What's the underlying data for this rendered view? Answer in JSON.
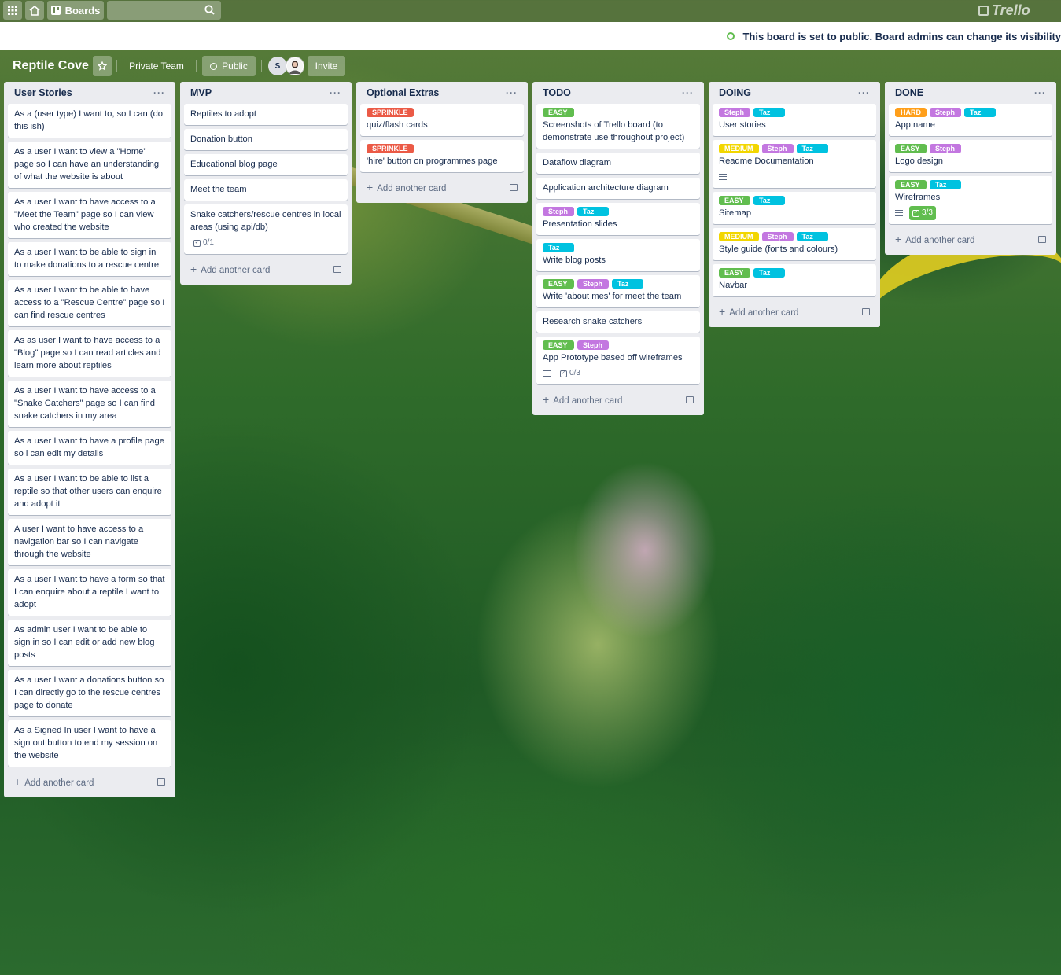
{
  "nav": {
    "boards_label": "Boards",
    "logo": "Trello"
  },
  "banner": {
    "text": "This board is set to public. Board admins can change its visibility"
  },
  "board": {
    "title": "Reptile Cove",
    "team": "Private Team",
    "visibility": "Public",
    "member_initial": "S",
    "invite": "Invite"
  },
  "colors": {
    "green": "#61bd4f",
    "yellow": "#f2d600",
    "orange": "#ff9f1a",
    "red": "#eb5a46",
    "purple": "#c377e0",
    "sky": "#00c2e0"
  },
  "add_card_label": "Add another card",
  "lists": [
    {
      "name": "User Stories",
      "cards": [
        {
          "title": "As a (user type) I want to, so I can (do this ish)"
        },
        {
          "title": "As a user I want to view a \"Home\" page so I can have an understanding of what the website is about"
        },
        {
          "title": "As a user I want to have access to a \"Meet the Team\" page so I can view who created the website"
        },
        {
          "title": "As a user I want to be able to sign in to make donations to a rescue centre"
        },
        {
          "title": "As a user I want to be able to have access to a \"Rescue Centre\" page so I can find rescue centres"
        },
        {
          "title": "As as user I want to have access to a \"Blog\" page so I can read articles and learn more about reptiles"
        },
        {
          "title": "As a user I want to have access to a \"Snake Catchers\" page so I can find snake catchers in my area"
        },
        {
          "title": "As a user I want to have a profile page so i can edit my details"
        },
        {
          "title": "As a user I want to be able to list a reptile so that other users can enquire and adopt it"
        },
        {
          "title": "A user I want to have access to a navigation bar so I can navigate through the website"
        },
        {
          "title": "As a user I want to have a form so that I can enquire about a reptile I want to adopt"
        },
        {
          "title": "As admin user I want to be able to sign in so I can edit or add new blog posts"
        },
        {
          "title": "As a user I want a donations button so I can directly go to the rescue centres page to donate"
        },
        {
          "title": "As a Signed In user I want to have a sign out button to end my session on the website"
        }
      ]
    },
    {
      "name": "MVP",
      "cards": [
        {
          "title": "Reptiles to adopt"
        },
        {
          "title": "Donation button"
        },
        {
          "title": "Educational blog page"
        },
        {
          "title": "Meet the team"
        },
        {
          "title": "Snake catchers/rescue centres in local areas (using api/db)",
          "checklist": "0/1"
        }
      ]
    },
    {
      "name": "Optional Extras",
      "cards": [
        {
          "title": "quiz/flash cards",
          "labels": [
            {
              "text": "SPRINKLE",
              "color": "#eb5a46"
            }
          ]
        },
        {
          "title": "'hire' button on programmes page",
          "labels": [
            {
              "text": "SPRINKLE",
              "color": "#eb5a46"
            }
          ]
        }
      ]
    },
    {
      "name": "TODO",
      "cards": [
        {
          "title": "Screenshots of Trello board (to demonstrate use throughout project)",
          "labels": [
            {
              "text": "EASY",
              "color": "#61bd4f"
            }
          ]
        },
        {
          "title": "Dataflow diagram"
        },
        {
          "title": "Application architecture diagram"
        },
        {
          "title": "Presentation slides",
          "labels": [
            {
              "text": "Steph",
              "color": "#c377e0"
            },
            {
              "text": "Taz",
              "color": "#00c2e0"
            }
          ]
        },
        {
          "title": "Write blog posts",
          "labels": [
            {
              "text": "Taz",
              "color": "#00c2e0"
            }
          ]
        },
        {
          "title": "Write 'about mes' for meet the team",
          "labels": [
            {
              "text": "EASY",
              "color": "#61bd4f"
            },
            {
              "text": "Steph",
              "color": "#c377e0"
            },
            {
              "text": "Taz",
              "color": "#00c2e0"
            }
          ]
        },
        {
          "title": "Research snake catchers"
        },
        {
          "title": "App Prototype based off wireframes",
          "labels": [
            {
              "text": "EASY",
              "color": "#61bd4f"
            },
            {
              "text": "Steph",
              "color": "#c377e0"
            }
          ],
          "description": true,
          "checklist": "0/3"
        }
      ]
    },
    {
      "name": "DOING",
      "cards": [
        {
          "title": "User stories",
          "labels": [
            {
              "text": "Steph",
              "color": "#c377e0"
            },
            {
              "text": "Taz",
              "color": "#00c2e0"
            }
          ]
        },
        {
          "title": "Readme Documentation",
          "labels": [
            {
              "text": "MEDIUM",
              "color": "#f2d600"
            },
            {
              "text": "Steph",
              "color": "#c377e0"
            },
            {
              "text": "Taz",
              "color": "#00c2e0"
            }
          ],
          "description": true
        },
        {
          "title": "Sitemap",
          "labels": [
            {
              "text": "EASY",
              "color": "#61bd4f"
            },
            {
              "text": "Taz",
              "color": "#00c2e0"
            }
          ]
        },
        {
          "title": "Style guide (fonts and colours)",
          "labels": [
            {
              "text": "MEDIUM",
              "color": "#f2d600"
            },
            {
              "text": "Steph",
              "color": "#c377e0"
            },
            {
              "text": "Taz",
              "color": "#00c2e0"
            }
          ]
        },
        {
          "title": "Navbar",
          "labels": [
            {
              "text": "EASY",
              "color": "#61bd4f"
            },
            {
              "text": "Taz",
              "color": "#00c2e0"
            }
          ]
        }
      ]
    },
    {
      "name": "DONE",
      "cards": [
        {
          "title": "App name",
          "labels": [
            {
              "text": "HARD",
              "color": "#ff9f1a"
            },
            {
              "text": "Steph",
              "color": "#c377e0"
            },
            {
              "text": "Taz",
              "color": "#00c2e0"
            }
          ]
        },
        {
          "title": "Logo design",
          "labels": [
            {
              "text": "EASY",
              "color": "#61bd4f"
            },
            {
              "text": "Steph",
              "color": "#c377e0"
            }
          ]
        },
        {
          "title": "Wireframes",
          "labels": [
            {
              "text": "EASY",
              "color": "#61bd4f"
            },
            {
              "text": "Taz",
              "color": "#00c2e0"
            }
          ],
          "description": true,
          "checklist": "3/3",
          "checklist_complete": true
        }
      ]
    }
  ]
}
